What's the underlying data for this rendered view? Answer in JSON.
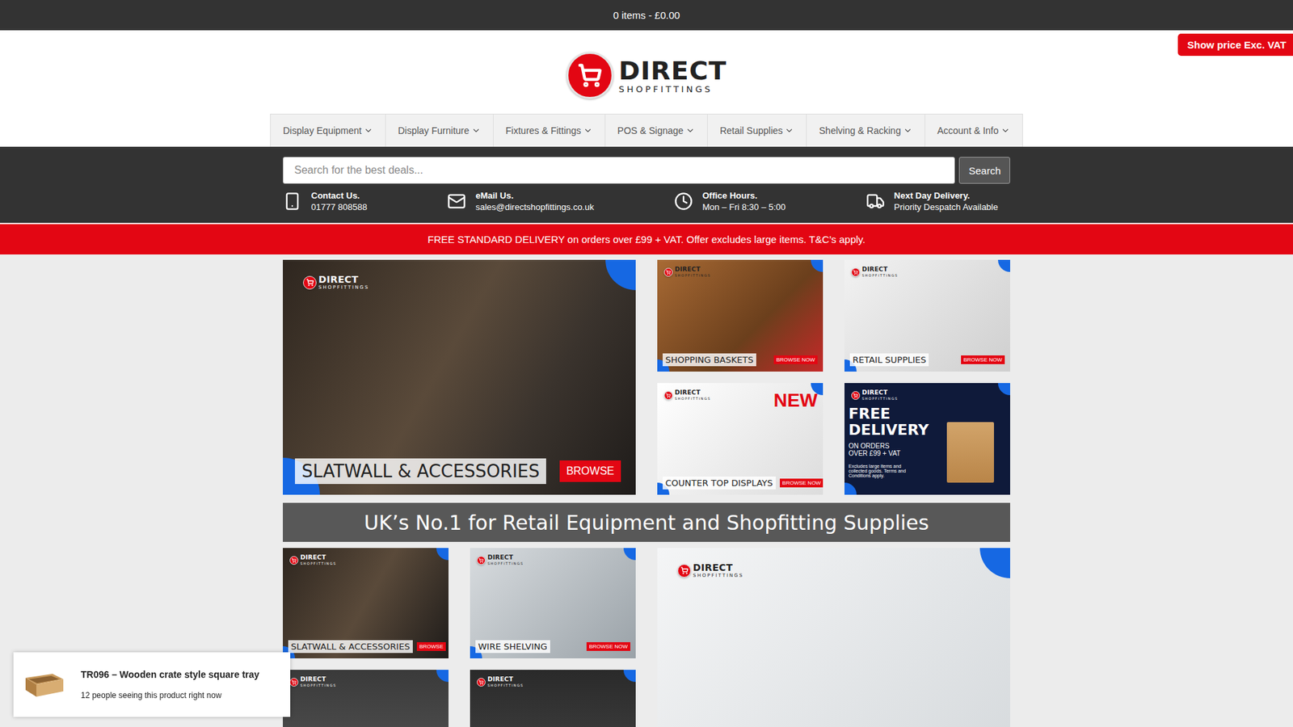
{
  "cart": {
    "summary": "0 items - £0.00"
  },
  "vat_toggle": {
    "label": "Show price Exc. VAT"
  },
  "logo": {
    "name": "DIRECT",
    "sub": "SHOPFITTINGS"
  },
  "nav": [
    {
      "label": "Display Equipment"
    },
    {
      "label": "Display Furniture"
    },
    {
      "label": "Fixtures & Fittings"
    },
    {
      "label": "POS & Signage"
    },
    {
      "label": "Retail Supplies"
    },
    {
      "label": "Shelving & Racking"
    },
    {
      "label": "Account & Info"
    }
  ],
  "search": {
    "placeholder": "Search for the best deals...",
    "button": "Search"
  },
  "contact": [
    {
      "title": "Contact Us.",
      "value": "01777 808588"
    },
    {
      "title": "eMail Us.",
      "value": "sales@directshopfittings.co.uk"
    },
    {
      "title": "Office Hours.",
      "value": "Mon – Fri 8:30 – 5:00"
    },
    {
      "title": "Next Day Delivery.",
      "value": "Priority Despatch Available"
    }
  ],
  "promo_bar": "FREE STANDARD DELIVERY on orders over £99 + VAT. Offer excludes large items. T&C’s apply.",
  "banners": [
    {
      "kind": "large",
      "label": "SLATWALL & ACCESSORIES",
      "button": "BROWSE"
    },
    {
      "kind": "small",
      "label": "SHOPPING BASKETS",
      "button": "BROWSE NOW"
    },
    {
      "kind": "small",
      "label": "RETAIL SUPPLIES",
      "button": "BROWSE NOW"
    },
    {
      "kind": "new",
      "label": "COUNTER TOP DISPLAYS",
      "button": "BROWSE NOW",
      "badge": "NEW"
    },
    {
      "kind": "delivery",
      "title": "FREE DELIVERY",
      "sub": "ON ORDERS OVER £99 + VAT",
      "note": "Excludes large items and collected goods. Terms and Conditions apply."
    }
  ],
  "headline": "UK’s No.1 for Retail Equipment and Shopfitting Supplies",
  "categories": [
    {
      "kind": "labelled",
      "label": "SLATWALL & ACCESSORIES",
      "button": "BROWSE"
    },
    {
      "kind": "labelled",
      "label": "WIRE SHELVING",
      "button": "BROWSE NOW"
    },
    {
      "kind": "feature"
    },
    {
      "kind": "plain"
    },
    {
      "kind": "plain"
    }
  ],
  "popup": {
    "title": "TR096 – Wooden crate style square tray",
    "text": "12 people seeing this product right now"
  }
}
